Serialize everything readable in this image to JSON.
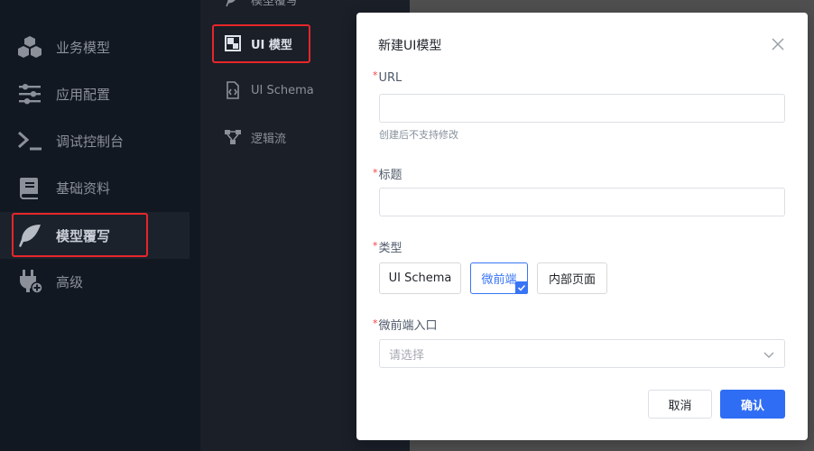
{
  "sidebar": {
    "items": [
      {
        "label": "业务模型",
        "icon": "cubes-icon"
      },
      {
        "label": "应用配置",
        "icon": "sliders-icon"
      },
      {
        "label": "调试控制台",
        "icon": "terminal-icon"
      },
      {
        "label": "基础资料",
        "icon": "book-icon"
      },
      {
        "label": "模型覆写",
        "icon": "feather-icon",
        "active": true
      },
      {
        "label": "高级",
        "icon": "plug-icon"
      }
    ]
  },
  "subnav": {
    "items": [
      {
        "label": "模型覆写",
        "icon": "feather-icon"
      },
      {
        "label": "UI 模型",
        "icon": "ui-model-icon",
        "active": true
      },
      {
        "label": "UI Schema",
        "icon": "code-file-icon"
      },
      {
        "label": "逻辑流",
        "icon": "flow-icon"
      }
    ]
  },
  "modal": {
    "title": "新建UI模型",
    "url_label": "URL",
    "url_value": "",
    "url_hint": "创建后不支持修改",
    "title_label": "标题",
    "title_value": "",
    "type_label": "类型",
    "type_options": [
      "UI Schema",
      "微前端",
      "内部页面"
    ],
    "type_selected": "微前端",
    "entry_label": "微前端入口",
    "entry_placeholder": "请选择",
    "required_mark": "*",
    "cancel_label": "取消",
    "confirm_label": "确认"
  },
  "colors": {
    "accent": "#2f6df4",
    "required": "#f53f3f",
    "highlight": "#e8262a",
    "sidebar_bg": "#121821"
  }
}
